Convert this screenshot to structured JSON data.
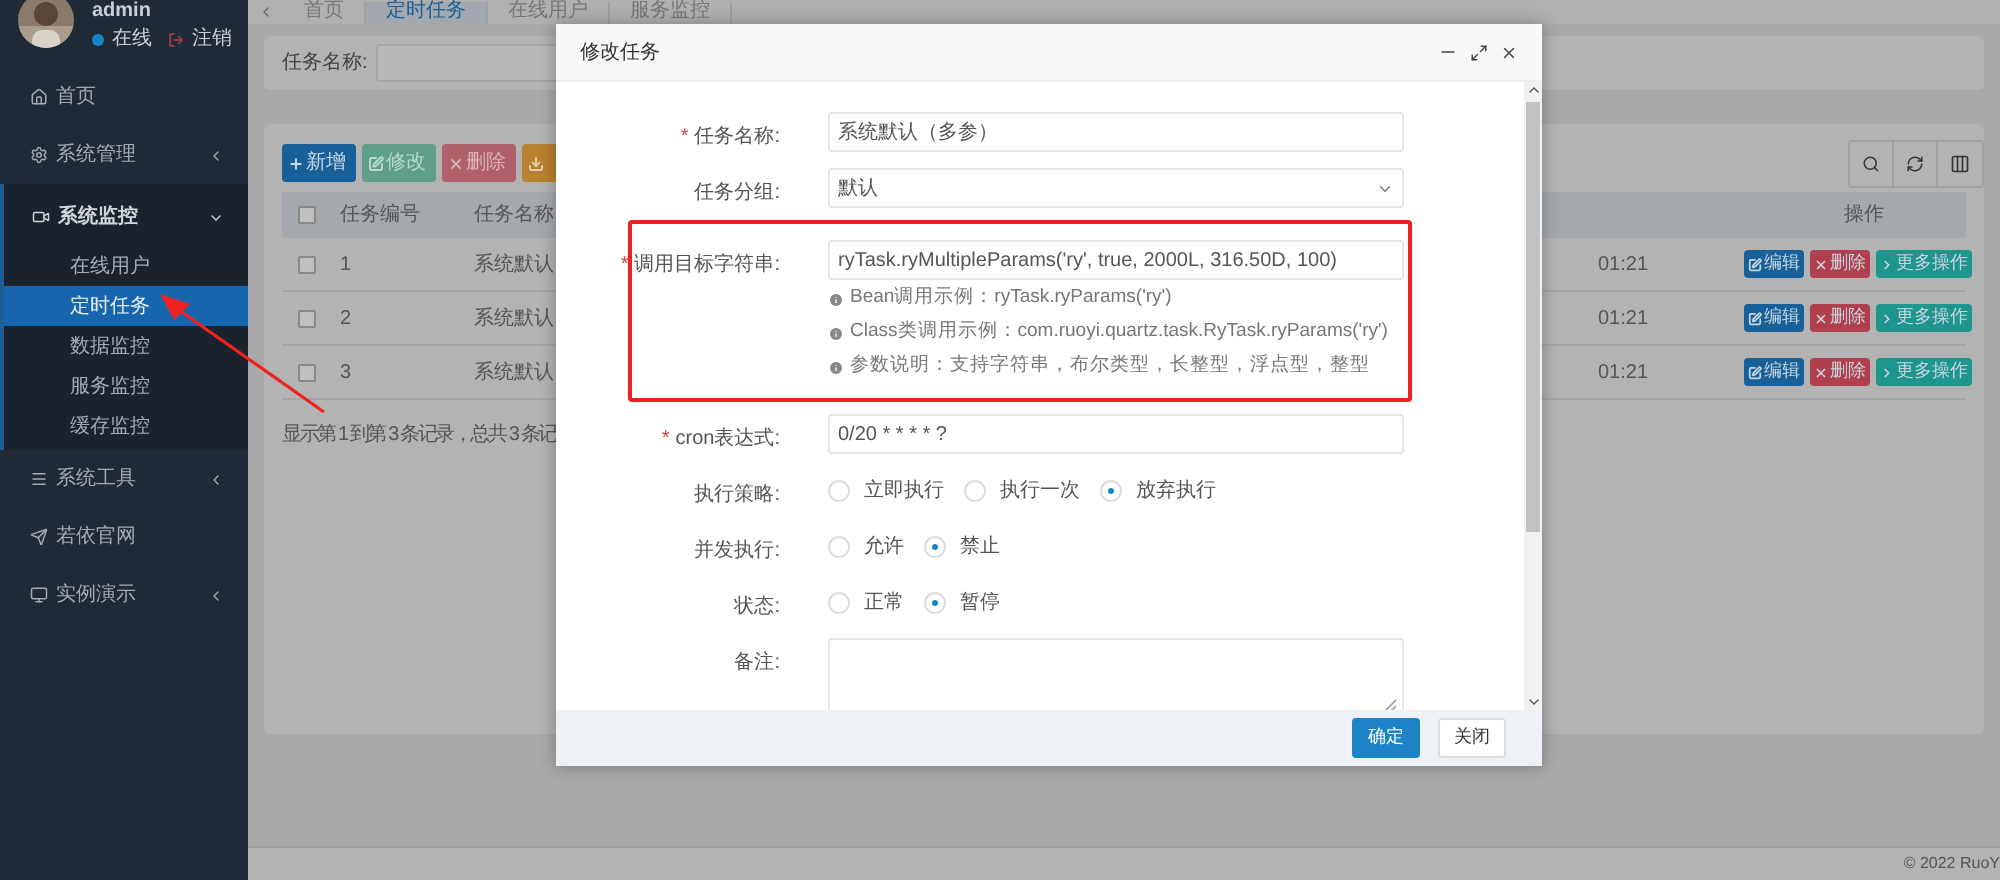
{
  "user": {
    "name": "admin",
    "status": "在线",
    "logout": "注销"
  },
  "sidebar": {
    "items": [
      {
        "label": "首页"
      },
      {
        "label": "系统管理",
        "expanded": false
      },
      {
        "label": "系统监控",
        "expanded": true,
        "children": [
          {
            "label": "在线用户",
            "selected": false
          },
          {
            "label": "定时任务",
            "selected": true
          },
          {
            "label": "数据监控",
            "selected": false
          },
          {
            "label": "服务监控",
            "selected": false
          },
          {
            "label": "缓存监控",
            "selected": false
          }
        ]
      },
      {
        "label": "系统工具",
        "expanded": false
      },
      {
        "label": "若依官网"
      },
      {
        "label": "实例演示",
        "expanded": false
      }
    ]
  },
  "tabs": [
    {
      "label": "首页",
      "selected": false
    },
    {
      "label": "定时任务",
      "selected": true
    },
    {
      "label": "在线用户",
      "selected": false
    },
    {
      "label": "服务监控",
      "selected": false
    }
  ],
  "search": {
    "label": "任务名称:"
  },
  "toolbar": [
    {
      "label": "新增",
      "kind": "add"
    },
    {
      "label": "修改",
      "kind": "edit"
    },
    {
      "label": "删除",
      "kind": "delete"
    },
    {
      "kind": "export"
    }
  ],
  "table": {
    "select_all_checked": false,
    "columns": [
      {
        "label": "任务编号"
      },
      {
        "label": "任务名称"
      },
      {
        "label": "操作"
      }
    ],
    "rows": [
      {
        "checked": false,
        "id": "1",
        "name": "系统默认",
        "time": "01:21",
        "actions": [
          "编辑",
          "删除",
          "更多操作"
        ]
      },
      {
        "checked": false,
        "id": "2",
        "name": "系统默认",
        "time": "01:21",
        "actions": [
          "编辑",
          "删除",
          "更多操作"
        ]
      },
      {
        "checked": false,
        "id": "3",
        "name": "系统默认",
        "time": "01:21",
        "actions": [
          "编辑",
          "删除",
          "更多操作"
        ]
      }
    ]
  },
  "pagination_info": "显示第 1 到第 3 条记录，总共 3 条记",
  "footer": "© 2022 RuoY",
  "dialog": {
    "title": "修改任务",
    "fields": [
      {
        "kind": "text",
        "label": "任务名称:",
        "required_mark": "*",
        "value": "系统默认（多参）"
      },
      {
        "kind": "select",
        "label": "任务分组:",
        "value": "默认"
      },
      {
        "kind": "text",
        "label": "调用目标字符串:",
        "required_mark": "*",
        "highlighted": true,
        "value": "ryTask.ryMultipleParams('ry', true, 2000L, 316.50D, 100)",
        "hints": [
          "Bean调用示例：ryTask.ryParams('ry')",
          "Class类调用示例：com.ruoyi.quartz.task.RyTask.ryParams('ry')",
          "参数说明：支持字符串，布尔类型，长整型，浮点型，整型"
        ]
      },
      {
        "kind": "text",
        "label": "cron表达式:",
        "required_mark": "*",
        "value": "0/20 * * * * ?"
      },
      {
        "kind": "radio",
        "label": "执行策略:",
        "options": [
          {
            "label": "立即执行",
            "selected": false
          },
          {
            "label": "执行一次",
            "selected": false
          },
          {
            "label": "放弃执行",
            "selected": true
          }
        ]
      },
      {
        "kind": "radio",
        "label": "并发执行:",
        "options": [
          {
            "label": "允许",
            "selected": false
          },
          {
            "label": "禁止",
            "selected": true
          }
        ]
      },
      {
        "kind": "radio",
        "label": "状态:",
        "options": [
          {
            "label": "正常",
            "selected": false
          },
          {
            "label": "暂停",
            "selected": true
          }
        ]
      },
      {
        "kind": "textarea",
        "label": "备注:"
      }
    ],
    "buttons": [
      {
        "label": "确定",
        "kind": "primary"
      },
      {
        "label": "关闭",
        "kind": "default"
      }
    ]
  }
}
